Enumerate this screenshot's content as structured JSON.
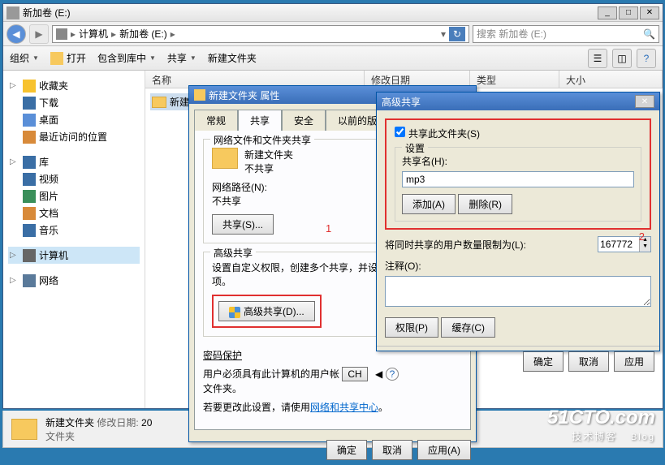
{
  "explorer": {
    "title": "新加卷 (E:)",
    "address_parts": [
      "计算机",
      "新加卷 (E:)"
    ],
    "search_placeholder": "搜索 新加卷 (E:)",
    "toolbar": {
      "organize": "组织",
      "open": "打开",
      "include": "包含到库中",
      "share": "共享",
      "newfolder": "新建文件夹"
    },
    "sidebar": {
      "favorites": "收藏夹",
      "downloads": "下载",
      "desktop": "桌面",
      "recent": "最近访问的位置",
      "libraries": "库",
      "videos": "视频",
      "pictures": "图片",
      "documents": "文档",
      "music": "音乐",
      "computer": "计算机",
      "network": "网络"
    },
    "columns": {
      "name": "名称",
      "modified": "修改日期",
      "type": "类型",
      "size": "大小"
    },
    "files": {
      "folder1": "新建…"
    },
    "status": {
      "name": "新建文件夹",
      "modlabel": "修改日期:",
      "modval": "20",
      "type": "文件夹"
    }
  },
  "propdlg": {
    "title": "新建文件夹 属性",
    "tabs": {
      "general": "常规",
      "sharing": "共享",
      "security": "安全",
      "previous": "以前的版本"
    },
    "group1": {
      "legend": "网络文件和文件夹共享",
      "name": "新建文件夹",
      "state": "不共享",
      "pathlabel": "网络路径(N):",
      "pathval": "不共享",
      "sharebtn": "共享(S)..."
    },
    "group2": {
      "legend": "高级共享",
      "desc": "设置自定义权限，创建多个共享，并设…",
      "desc2": "项。",
      "advbtn": "高级共享(D)..."
    },
    "group3": {
      "legend": "密码保护",
      "desc1": "用户必须具有此计算机的用户帐",
      "desc1b": "文件夹。",
      "desc2a": "若要更改此设置，请使用",
      "link": "网络和共享中心",
      "desc2b": "。"
    },
    "buttons": {
      "ok": "确定",
      "cancel": "取消",
      "apply": "应用(A)"
    },
    "annot1": "1",
    "chbtn": "CH"
  },
  "advdlg": {
    "title": "高级共享",
    "checkbox": "共享此文件夹(S)",
    "settings": "设置",
    "sharename_label": "共享名(H):",
    "sharename_value": "mp3",
    "addbtn": "添加(A)",
    "removebtn": "删除(R)",
    "limit_label": "将同时共享的用户数量限制为(L):",
    "limit_value": "167772",
    "comment_label": "注释(O):",
    "permbtn": "权限(P)",
    "cachebtn": "缓存(C)",
    "buttons": {
      "ok": "确定",
      "cancel": "取消",
      "apply": "应用"
    },
    "annot2": "2"
  },
  "watermark": {
    "line1": "51CTO.com",
    "line2": "技术博客",
    "line3": "Blog"
  }
}
